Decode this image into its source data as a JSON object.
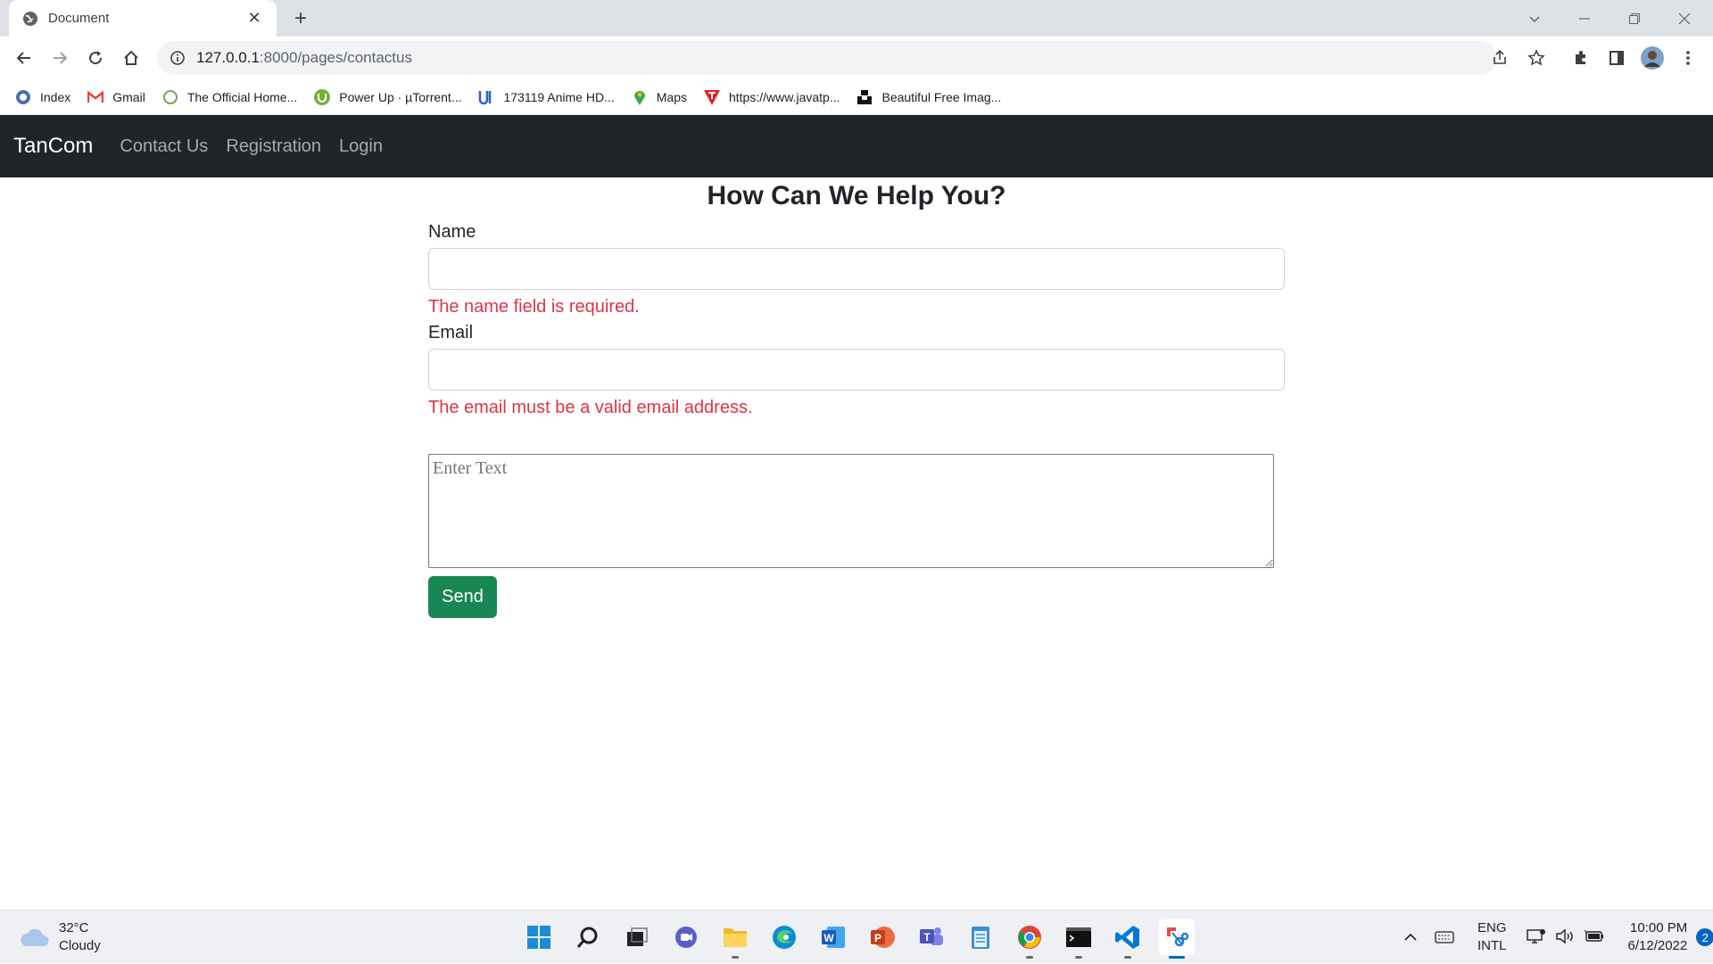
{
  "browser": {
    "tab_title": "Document",
    "url_host": "127.0.0.1",
    "url_rest": ":8000/pages/contactus",
    "bookmarks": [
      {
        "label": "Index",
        "icon": "globe-icon"
      },
      {
        "label": "Gmail",
        "icon": "gmail-icon"
      },
      {
        "label": "The Official Home...",
        "icon": "leaf-icon"
      },
      {
        "label": "Power Up · µTorrent...",
        "icon": "utorrent-icon"
      },
      {
        "label": "173119 Anime HD...",
        "icon": "wallpaper-icon"
      },
      {
        "label": "Maps",
        "icon": "maps-pin-icon"
      },
      {
        "label": "https://www.javatp...",
        "icon": "javatpoint-icon"
      },
      {
        "label": "Beautiful Free Imag...",
        "icon": "unsplash-icon"
      }
    ]
  },
  "navbar": {
    "brand": "TanCom",
    "links": [
      "Contact Us",
      "Registration",
      "Login"
    ]
  },
  "form": {
    "heading": "How Can We Help You?",
    "name_label": "Name",
    "name_value": "",
    "name_error": "The name field is required.",
    "email_label": "Email",
    "email_value": "",
    "email_error": "The email must be a valid email address.",
    "message_placeholder": "Enter Text",
    "send_label": "Send"
  },
  "taskbar": {
    "temperature": "32°C",
    "weather": "Cloudy",
    "lang_1": "ENG",
    "lang_2": "INTL",
    "time": "10:00 PM",
    "date": "6/12/2022",
    "notifications": "2"
  },
  "colors": {
    "navbar_bg": "#212529",
    "error": "#dc3545",
    "send_button": "#198754"
  }
}
